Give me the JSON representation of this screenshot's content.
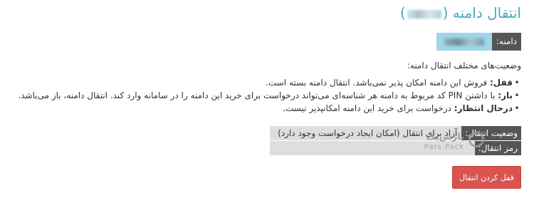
{
  "page": {
    "title_prefix": "انتقال دامنه (",
    "title_suffix": ")"
  },
  "domain": {
    "label": "دامنه:"
  },
  "statuses": {
    "intro": "وضعیت‌های مختلف انتقال دامنه:",
    "items": [
      {
        "name": "قفل:",
        "text": "فروش این دامنه امکان پذیر نمی‌باشد. انتقال دامنه بسته است."
      },
      {
        "name": "باز:",
        "text": "با داشتن PIN کد مربوط به دامنه هر شناسه‌ای می‌تواند درخواست برای خرید این دامنه را در سامانه وارد کند. انتقال دامنه، باز می‌باشد."
      },
      {
        "name": "درحال انتظار:",
        "text": "درخواست برای خرید این دامنه امکانپذیر نیست."
      }
    ]
  },
  "transfer": {
    "status_label": "وضعیت انتقال:",
    "status_value": "آزاد برای انتقال (امکان ایجاد درخواست وجود دارد)",
    "code_label": "رمز انتقال:",
    "code_value": ""
  },
  "watermark": {
    "fa": "پارس‌پک",
    "en": "Pars Pack"
  },
  "actions": {
    "lock_transfer": "قفل کردن انتقال"
  },
  "colors": {
    "title": "#4aa8c6",
    "label_bg": "#555555",
    "domain_value_bg": "#9fd5e8",
    "info_value_bg": "#dedede",
    "button_bg": "#d9534f"
  }
}
